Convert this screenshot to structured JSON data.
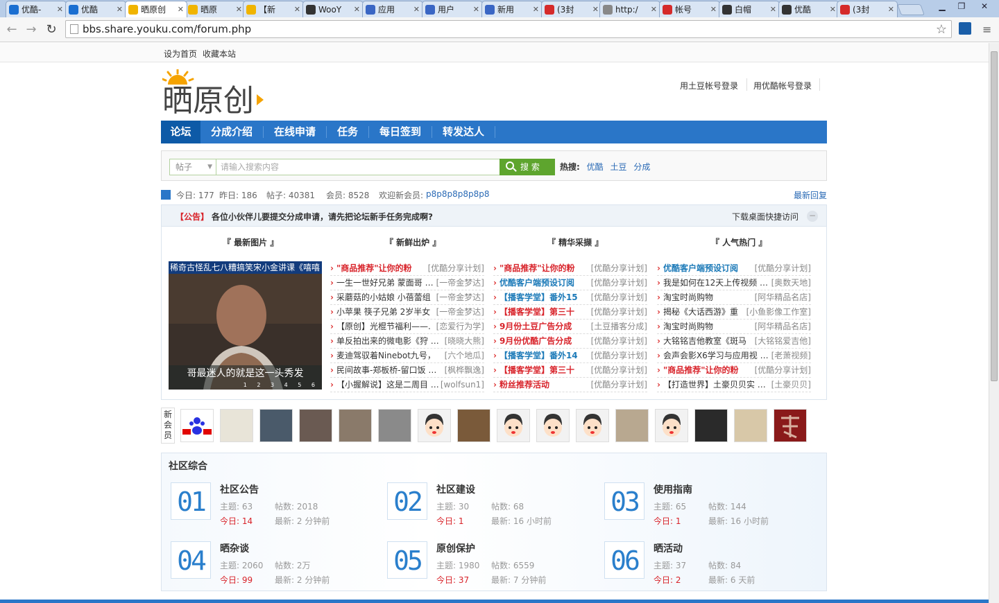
{
  "browser": {
    "tabs": [
      {
        "title": "优酷-",
        "icon": "youku-icon",
        "color": "#1b6fd1"
      },
      {
        "title": "优酷",
        "icon": "youku-icon",
        "color": "#1b6fd1"
      },
      {
        "title": "晒原创",
        "icon": "sun-icon",
        "color": "#f0b400"
      },
      {
        "title": "晒原",
        "icon": "sun-icon",
        "color": "#f0b400"
      },
      {
        "title": "【新",
        "icon": "sun-icon",
        "color": "#f0b400"
      },
      {
        "title": "WooY",
        "icon": "wooyun-icon",
        "color": "#333333"
      },
      {
        "title": "应用",
        "icon": "app-icon",
        "color": "#3a66c4"
      },
      {
        "title": "用户",
        "icon": "play-icon",
        "color": "#3a66c4"
      },
      {
        "title": "新用",
        "icon": "play-icon",
        "color": "#3a66c4"
      },
      {
        "title": "(3封",
        "icon": "weibo-icon",
        "color": "#d52a2a"
      },
      {
        "title": "http:/",
        "icon": "page-icon",
        "color": "#888888"
      },
      {
        "title": "帐号",
        "icon": "weibo-icon",
        "color": "#d52a2a"
      },
      {
        "title": "白帽",
        "icon": "wooyun-icon",
        "color": "#333333"
      },
      {
        "title": "优酷",
        "icon": "wooyun-icon",
        "color": "#333333"
      },
      {
        "title": "(3封",
        "icon": "weibo-icon",
        "color": "#d52a2a"
      }
    ],
    "url": "bbs.share.youku.com/forum.php"
  },
  "topbar": {
    "set_home": "设为首页",
    "bookmark": "收藏本站"
  },
  "logo": {
    "text": "晒原创"
  },
  "login": {
    "tudou": "用土豆帐号登录",
    "youku": "用优酷帐号登录"
  },
  "nav": [
    "论坛",
    "分成介绍",
    "在线申请",
    "任务",
    "每日签到",
    "转发达人"
  ],
  "search": {
    "type": "帖子",
    "placeholder": "请输入搜索内容",
    "button": "搜 索",
    "hot_label": "热搜:",
    "hot": [
      "优酷",
      "土豆",
      "分成"
    ]
  },
  "stats": {
    "today": "今日: 177",
    "yesterday": "昨日: 186",
    "posts": "帖子: 40381",
    "members": "会员: 8528",
    "welcome": "欢迎新会员:",
    "new_member": "p8p8p8p8p8p8",
    "latest": "最新回复"
  },
  "notice": {
    "tag": "【公告】",
    "text": "各位小伙伴儿要提交分成申请，请先把论坛新手任务完成啊?",
    "desktop": "下载桌面快捷访问"
  },
  "portal": {
    "headers": [
      "『 最新图片 』",
      "『 新鲜出炉 』",
      "『 精华采撷 』",
      "『 人气热门 』"
    ],
    "photo_caption": "稀奇古怪乱七八糟搞笑宋小金讲课《嘻嘻",
    "photo_subtitle": "哥最迷人的就是这一头秀发",
    "photo_pages": "1 2 3 4 5 6",
    "fresh": [
      {
        "t": "\"商品推荐\"让你的粉",
        "s": "[优酷分享计划]",
        "style": "red"
      },
      {
        "t": "一生一世好兄弟 蒙面哥 …",
        "s": "[一帝金梦达]",
        "style": ""
      },
      {
        "t": "采蘑菇的小姑娘 小蓓蕾组",
        "s": "[一帝金梦达]",
        "style": ""
      },
      {
        "t": "小苹果 筷子兄弟 2岁半女",
        "s": "[一帝金梦达]",
        "style": ""
      },
      {
        "t": "【原创】光棍节福利——.",
        "s": "[恋爱行为学]",
        "style": ""
      },
      {
        "t": "单反拍出来的微电影《狩 …",
        "s": "[晓晓大熊]",
        "style": ""
      },
      {
        "t": "麦迪驾驭着Ninebot九号，",
        "s": "[六个地瓜]",
        "style": ""
      },
      {
        "t": "民间故事-郑板桥-留口饭 …",
        "s": "[枫桦飘逸]",
        "style": ""
      },
      {
        "t": "【小握解说】这是二周目 …",
        "s": "[wolfsun1]",
        "style": ""
      }
    ],
    "essence": [
      {
        "t": "\"商品推荐\"让你的粉",
        "s": "[优酷分享计划]",
        "style": "red"
      },
      {
        "t": "优酷客户端预设订阅",
        "s": "[优酷分享计划]",
        "style": "blue"
      },
      {
        "t": "【播客学堂】番外15",
        "s": "[优酷分享计划]",
        "style": "blue"
      },
      {
        "t": "【播客学堂】第三十",
        "s": "[优酷分享计划]",
        "style": "red"
      },
      {
        "t": "9月份土豆广告分成",
        "s": "[土豆播客分成]",
        "style": "red"
      },
      {
        "t": "9月份优酷广告分成",
        "s": "[优酷分享计划]",
        "style": "red"
      },
      {
        "t": "【播客学堂】番外14",
        "s": "[优酷分享计划]",
        "style": "blue"
      },
      {
        "t": "【播客学堂】第三十",
        "s": "[优酷分享计划]",
        "style": "red"
      },
      {
        "t": "粉丝推荐活动",
        "s": "[优酷分享计划]",
        "style": "red"
      }
    ],
    "popular": [
      {
        "t": "优酷客户端预设订阅",
        "s": "[优酷分享计划]",
        "style": "blue"
      },
      {
        "t": "我是如何在12天上传视频 …",
        "s": "[奥数天地]",
        "style": ""
      },
      {
        "t": "淘宝时尚购物",
        "s": "[阿华精品名店]",
        "style": ""
      },
      {
        "t": "揭秘《大话西游》重",
        "s": "[小鱼影像工作室]",
        "style": ""
      },
      {
        "t": "淘宝时尚购物",
        "s": "[阿华精品名店]",
        "style": ""
      },
      {
        "t": "大铭铭吉他教室《斑马",
        "s": "[大铭铭爱吉他]",
        "style": ""
      },
      {
        "t": "会声会影X6学习与应用视 …",
        "s": "[老萧视频]",
        "style": ""
      },
      {
        "t": "\"商品推荐\"让你的粉",
        "s": "[优酷分享计划]",
        "style": "red"
      },
      {
        "t": "【打造世界】土豪贝贝实 …",
        "s": "[土豪贝贝]",
        "style": ""
      }
    ]
  },
  "new_members": {
    "label": "新会员",
    "avatars": [
      "baidu-logo",
      "sketch-girl",
      "man-portrait",
      "woman-portrait",
      "man-selfie",
      "silhouette",
      "cartoon-face",
      "baby",
      "cartoon-face",
      "cartoon-face",
      "cartoon-face",
      "soldier",
      "cartoon-face",
      "dark-portrait",
      "puppy",
      "love-character"
    ]
  },
  "section": {
    "title": "社区综合",
    "forums": [
      {
        "num": "01",
        "name": "社区公告",
        "topics": "63",
        "posts": "2018",
        "today": "14",
        "latest": "2 分钟前"
      },
      {
        "num": "02",
        "name": "社区建设",
        "topics": "30",
        "posts": "68",
        "today": "1",
        "latest": "16 小时前"
      },
      {
        "num": "03",
        "name": "使用指南",
        "topics": "65",
        "posts": "144",
        "today": "1",
        "latest": "16 小时前"
      },
      {
        "num": "04",
        "name": "晒杂谈",
        "topics": "2060",
        "posts": "2万",
        "today": "99",
        "latest": "2 分钟前"
      },
      {
        "num": "05",
        "name": "原创保护",
        "topics": "1980",
        "posts": "6559",
        "today": "37",
        "latest": "7 分钟前"
      },
      {
        "num": "06",
        "name": "晒活动",
        "topics": "37",
        "posts": "84",
        "today": "2",
        "latest": "6 天前"
      }
    ],
    "labels": {
      "topics": "主题:",
      "posts": "帖数:",
      "today": "今日:",
      "latest": "最新:"
    }
  }
}
